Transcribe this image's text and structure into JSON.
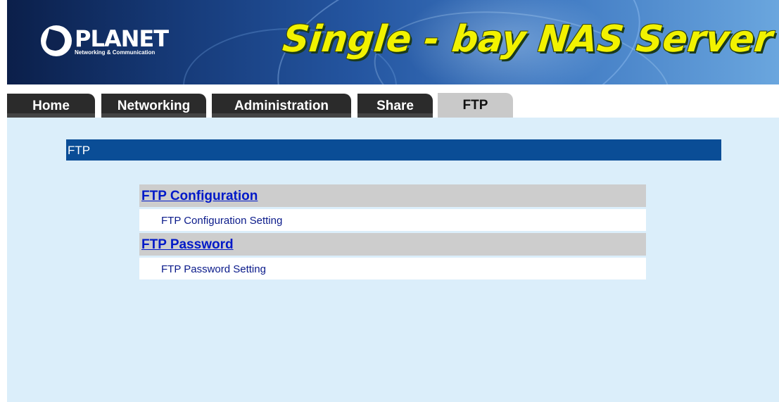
{
  "banner": {
    "logo_text": "PLANET",
    "logo_tagline": "Networking & Communication",
    "title": "Single - bay NAS Server"
  },
  "tabs": [
    {
      "label": "Home",
      "active": false
    },
    {
      "label": "Networking",
      "active": false
    },
    {
      "label": "Administration",
      "active": false
    },
    {
      "label": "Share",
      "active": false
    },
    {
      "label": "FTP",
      "active": true
    }
  ],
  "section": {
    "title": "FTP"
  },
  "menu": [
    {
      "heading": "FTP Configuration",
      "item": "FTP Configuration Setting"
    },
    {
      "heading": "FTP Password",
      "item": "FTP Password Setting"
    }
  ],
  "colors": {
    "panel_bg": "#dbeefa",
    "section_header_bg": "#0a4d96",
    "link": "#0019c8",
    "banner_title": "#f2f200"
  }
}
